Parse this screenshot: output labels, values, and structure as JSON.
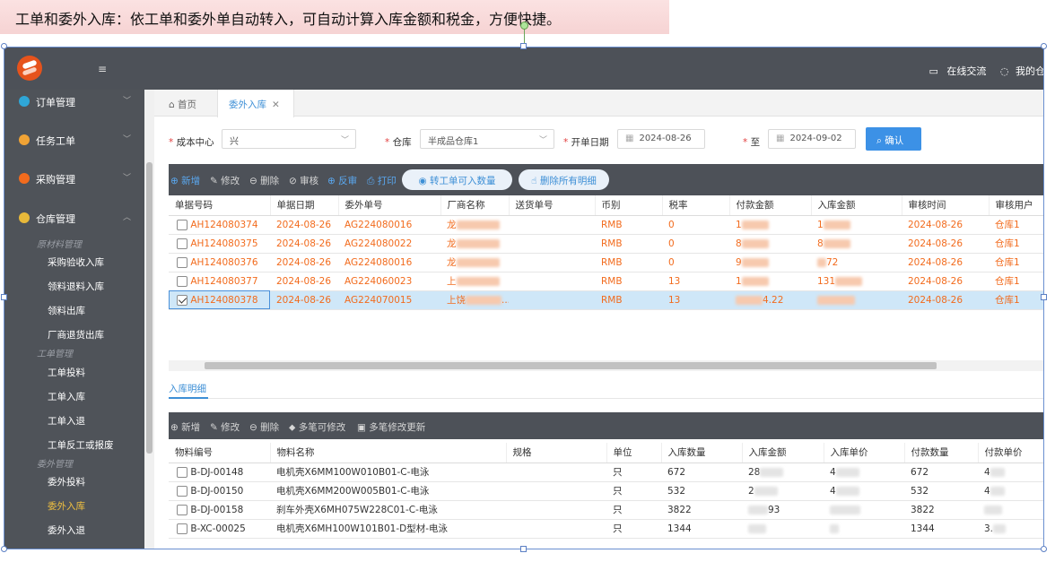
{
  "caption": "工单和委外入库：依工单和委外单自动转入，可自动计算入库金额和税金，方便快捷。",
  "topbar": {
    "menu_icon": "≡",
    "online_chat": "在线交流",
    "my_account": "我的仓"
  },
  "sidebar": {
    "items": [
      {
        "label": "订单管理",
        "icon_color": "#2fa6d7"
      },
      {
        "label": "任务工单",
        "icon_color": "#f0a335"
      },
      {
        "label": "采购管理",
        "icon_color": "#f26b1d"
      },
      {
        "label": "仓库管理",
        "icon_color": "#e8b93a"
      }
    ],
    "groups": {
      "raw": "原材料管理",
      "work": "工单管理",
      "outsource": "委外管理"
    },
    "subitems": {
      "raw": [
        "采购验收入库",
        "领料退料入库",
        "领料出库",
        "厂商退货出库"
      ],
      "work": [
        "工单投料",
        "工单入库",
        "工单入退",
        "工单反工或报废"
      ],
      "outsource": [
        "委外投料",
        "委外入库",
        "委外入退"
      ]
    }
  },
  "tabs": {
    "home": "首页",
    "current": "委外入库",
    "close": "✕"
  },
  "filters": {
    "cost_center_label": "成本中心",
    "cost_center_value": "兴",
    "warehouse_label": "仓库",
    "warehouse_value": "半成品仓库1",
    "start_label": "开单日期",
    "start_value": "2024-08-26",
    "to_label": "至",
    "end_value": "2024-09-02",
    "confirm": "确认"
  },
  "toolbar": {
    "add": "新增",
    "edit": "修改",
    "delete": "删除",
    "approve": "审核",
    "unapprove": "反审",
    "print": "打印",
    "transfer": "转工单可入数量",
    "delete_all": "删除所有明细"
  },
  "master_table": {
    "columns": [
      "单据号码",
      "单据日期",
      "委外单号",
      "厂商名称",
      "送货单号",
      "币别",
      "税率",
      "付款金额",
      "入库金额",
      "审核时间",
      "审核用户"
    ],
    "rows": [
      {
        "no": "AH124080374",
        "date": "2024-08-26",
        "order": "AG224080016",
        "vendor": "龙",
        "currency": "RMB",
        "tax": "0",
        "pay": "1",
        "amount": "1",
        "time": "2024-08-26",
        "user": "仓库1",
        "checked": false
      },
      {
        "no": "AH124080375",
        "date": "2024-08-26",
        "order": "AG224080022",
        "vendor": "龙",
        "currency": "RMB",
        "tax": "0",
        "pay": "8",
        "amount": "8",
        "time": "2024-08-26",
        "user": "仓库1",
        "checked": false
      },
      {
        "no": "AH124080376",
        "date": "2024-08-26",
        "order": "AG224080016",
        "vendor": "龙",
        "currency": "RMB",
        "tax": "0",
        "pay": "9",
        "amount": "72",
        "time": "2024-08-26",
        "user": "仓库1",
        "checked": false
      },
      {
        "no": "AH124080377",
        "date": "2024-08-26",
        "order": "AG224060023",
        "vendor": "上",
        "currency": "RMB",
        "tax": "13",
        "pay": "1",
        "amount": "131",
        "time": "2024-08-26",
        "user": "仓库1",
        "checked": false
      },
      {
        "no": "AH124080378",
        "date": "2024-08-26",
        "order": "AG224070015",
        "vendor": "上饶",
        "currency": "RMB",
        "tax": "13",
        "pay": "4.22",
        "amount": "",
        "time": "2024-08-26",
        "user": "仓库1",
        "checked": true
      }
    ]
  },
  "detail": {
    "title": "入库明细",
    "toolbar": {
      "add": "新增",
      "edit": "修改",
      "delete": "删除",
      "multi_allow": "多笔可修改",
      "multi_update": "多笔修改更新"
    },
    "columns": [
      "物料编号",
      "物料名称",
      "规格",
      "单位",
      "入库数量",
      "入库金额",
      "入库单价",
      "付款数量",
      "付款单价"
    ],
    "rows": [
      {
        "code": "B-DJ-00148",
        "name": "电机壳X6MM100W010B01-C-电泳",
        "spec": "",
        "unit": "只",
        "qty": "672",
        "amount": "28",
        "price": "4",
        "pay_qty": "672",
        "pay_price": "4"
      },
      {
        "code": "B-DJ-00150",
        "name": "电机壳X6MM200W005B01-C-电泳",
        "spec": "",
        "unit": "只",
        "qty": "532",
        "amount": "2",
        "price": "4",
        "pay_qty": "532",
        "pay_price": "4"
      },
      {
        "code": "B-DJ-00158",
        "name": "刹车外壳X6MH075W228C01-C-电泳",
        "spec": "",
        "unit": "只",
        "qty": "3822",
        "amount": "93",
        "price": "",
        "pay_qty": "3822",
        "pay_price": ""
      },
      {
        "code": "B-XC-00025",
        "name": "电机壳X6MH100W101B01-D型材-电泳",
        "spec": "",
        "unit": "只",
        "qty": "1344",
        "amount": "",
        "price": "",
        "pay_qty": "1344",
        "pay_price": "3."
      }
    ]
  }
}
